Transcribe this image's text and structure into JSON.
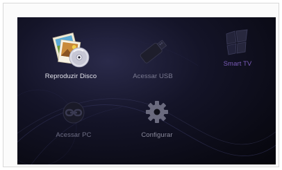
{
  "menu": {
    "items": [
      {
        "label": "Reproduzir Disco",
        "icon": "disc-photos-icon",
        "selected": true
      },
      {
        "label": "Acessar USB",
        "icon": "usb-drive-icon",
        "selected": false
      },
      {
        "label": "Smart TV",
        "icon": "smart-tv-icon",
        "selected": false
      },
      {
        "label": "Acessar PC",
        "icon": "pc-link-icon",
        "selected": false
      },
      {
        "label": "Configurar",
        "icon": "gear-icon",
        "selected": false
      }
    ]
  },
  "colors": {
    "background": "#0a0a14",
    "selected_label": "#e6e6ee",
    "smart_tv_label": "#7a5cb8",
    "inactive_label": "#7c7c92"
  }
}
